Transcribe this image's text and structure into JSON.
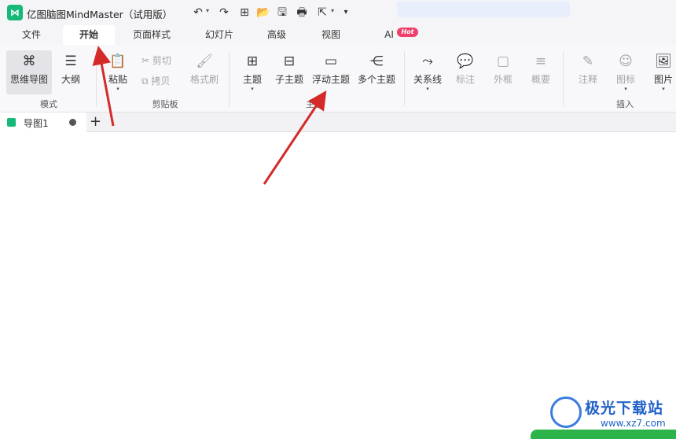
{
  "app": {
    "logo_text": "⋈",
    "title": "亿图脑图MindMaster（试用版）"
  },
  "quick_access": {
    "undo_label": "↶",
    "redo_label": "↷",
    "new_label": "⊞",
    "open_label": "📂",
    "save_label": "🖫",
    "print_label": "🖶",
    "export_label": "⇱",
    "more_label": "▾"
  },
  "menu": {
    "tabs": [
      {
        "label": "文件"
      },
      {
        "label": "开始"
      },
      {
        "label": "页面样式"
      },
      {
        "label": "幻灯片"
      },
      {
        "label": "高级"
      },
      {
        "label": "视图"
      },
      {
        "label": "AI"
      }
    ],
    "hot_badge": "Hot"
  },
  "ribbon": {
    "mode": {
      "mindmap": "思维导图",
      "outline": "大纲",
      "group_label": "模式"
    },
    "clipboard": {
      "paste": "粘贴",
      "cut": "剪切",
      "copy": "拷贝",
      "format_painter": "格式刷",
      "group_label": "剪贴板"
    },
    "topic": {
      "topic": "主题",
      "subtopic": "子主题",
      "floating": "浮动主题",
      "multiple": "多个主题",
      "group_label": "主题"
    },
    "insert": {
      "relationship": "关系线",
      "callout": "标注",
      "boundary": "外框",
      "summary": "概要",
      "note": "注释",
      "icon": "图标",
      "image": "图片",
      "group_label": "插入"
    }
  },
  "doc_tabs": [
    {
      "label": "导图1"
    }
  ],
  "add_tab_label": "+",
  "watermark": {
    "text": "极光下载站",
    "url": "www.xz7.com"
  },
  "colors": {
    "accent": "#17b978",
    "arrow": "#d42a2a",
    "hot": "#ef3f6b",
    "watermark": "#1f62c8"
  }
}
